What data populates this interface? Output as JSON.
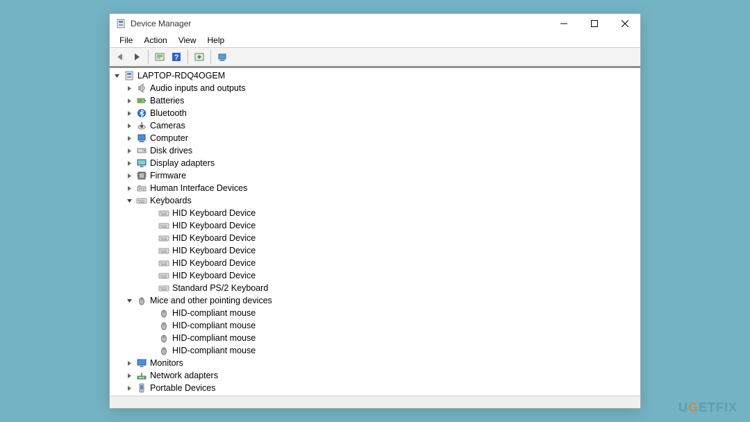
{
  "window": {
    "title": "Device Manager"
  },
  "menu": {
    "file": "File",
    "action": "Action",
    "view": "View",
    "help": "Help"
  },
  "tree": {
    "root": "LAPTOP-RDQ4OGEM",
    "categories": [
      {
        "label": "Audio inputs and outputs",
        "expanded": false,
        "icon": "audio"
      },
      {
        "label": "Batteries",
        "expanded": false,
        "icon": "battery"
      },
      {
        "label": "Bluetooth",
        "expanded": false,
        "icon": "bluetooth"
      },
      {
        "label": "Cameras",
        "expanded": false,
        "icon": "camera"
      },
      {
        "label": "Computer",
        "expanded": false,
        "icon": "computer"
      },
      {
        "label": "Disk drives",
        "expanded": false,
        "icon": "disk"
      },
      {
        "label": "Display adapters",
        "expanded": false,
        "icon": "display"
      },
      {
        "label": "Firmware",
        "expanded": false,
        "icon": "firmware"
      },
      {
        "label": "Human Interface Devices",
        "expanded": false,
        "icon": "hid"
      },
      {
        "label": "Keyboards",
        "expanded": true,
        "icon": "keyboard",
        "children": [
          {
            "label": "HID Keyboard Device",
            "icon": "keyboard"
          },
          {
            "label": "HID Keyboard Device",
            "icon": "keyboard"
          },
          {
            "label": "HID Keyboard Device",
            "icon": "keyboard"
          },
          {
            "label": "HID Keyboard Device",
            "icon": "keyboard"
          },
          {
            "label": "HID Keyboard Device",
            "icon": "keyboard"
          },
          {
            "label": "HID Keyboard Device",
            "icon": "keyboard"
          },
          {
            "label": "Standard PS/2 Keyboard",
            "icon": "keyboard"
          }
        ]
      },
      {
        "label": "Mice and other pointing devices",
        "expanded": true,
        "icon": "mouse",
        "children": [
          {
            "label": "HID-compliant mouse",
            "icon": "mouse"
          },
          {
            "label": "HID-compliant mouse",
            "icon": "mouse"
          },
          {
            "label": "HID-compliant mouse",
            "icon": "mouse"
          },
          {
            "label": "HID-compliant mouse",
            "icon": "mouse"
          }
        ]
      },
      {
        "label": "Monitors",
        "expanded": false,
        "icon": "monitor"
      },
      {
        "label": "Network adapters",
        "expanded": false,
        "icon": "network"
      },
      {
        "label": "Portable Devices",
        "expanded": false,
        "icon": "portable"
      }
    ]
  },
  "watermark": {
    "pre": "U",
    "g": "G",
    "mid": "E",
    "post": "TFIX"
  }
}
